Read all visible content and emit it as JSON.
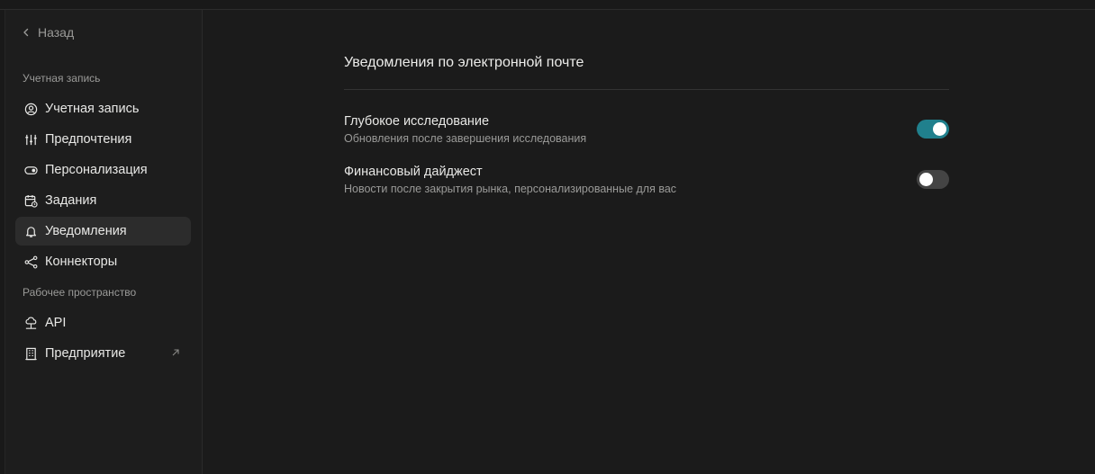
{
  "back": {
    "label": "Назад"
  },
  "sidebar": {
    "sections": [
      {
        "label": "Учетная запись"
      },
      {
        "label": "Рабочее пространство"
      }
    ],
    "items": [
      {
        "label": "Учетная запись",
        "icon": "user-circle-icon"
      },
      {
        "label": "Предпочтения",
        "icon": "sliders-icon"
      },
      {
        "label": "Персонализация",
        "icon": "toggle-icon"
      },
      {
        "label": "Задания",
        "icon": "calendar-clock-icon"
      },
      {
        "label": "Уведомления",
        "icon": "bell-icon",
        "active": true
      },
      {
        "label": "Коннекторы",
        "icon": "share-nodes-icon"
      },
      {
        "label": "API",
        "icon": "cloud-network-icon"
      },
      {
        "label": "Предприятие",
        "icon": "building-icon",
        "external": true
      }
    ]
  },
  "main": {
    "heading": "Уведомления по электронной почте",
    "settings": [
      {
        "title": "Глубокое исследование",
        "description": "Обновления после завершения исследования",
        "enabled": true
      },
      {
        "title": "Финансовый дайджест",
        "description": "Новости после закрытия рынка, персонализированные для вас",
        "enabled": false
      }
    ]
  },
  "colors": {
    "accent": "#20808d",
    "background": "#191919",
    "sidebar": "#1d1d1d",
    "active_item": "#2c2c2c"
  }
}
